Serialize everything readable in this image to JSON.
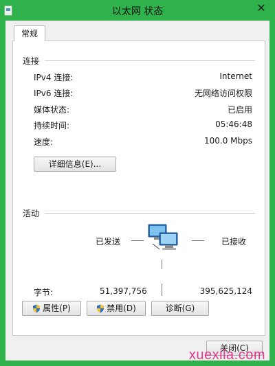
{
  "window": {
    "title": "以太网 状态",
    "close_glyph": "✕"
  },
  "tabs": [
    {
      "label": "常规"
    }
  ],
  "connection": {
    "header": "连接",
    "rows": [
      {
        "label": "IPv4 连接:",
        "value": "Internet"
      },
      {
        "label": "IPv6 连接:",
        "value": "无网络访问权限"
      },
      {
        "label": "媒体状态:",
        "value": "已启用"
      },
      {
        "label": "持续时间:",
        "value": "05:46:48"
      },
      {
        "label": "速度:",
        "value": "100.0 Mbps"
      }
    ],
    "details_button": "详细信息(E)..."
  },
  "activity": {
    "header": "活动",
    "sent_label": "已发送",
    "received_label": "已接收",
    "bytes_label": "字节:",
    "bytes_sent": "51,397,756",
    "bytes_received": "395,625,124"
  },
  "buttons": {
    "properties": "属性(P)",
    "disable": "禁用(D)",
    "diagnose": "诊断(G)",
    "close": "关闭(C)"
  },
  "icons": {
    "shield": "uac-shield-icon",
    "network": "network-computers-icon"
  },
  "watermark": "xuexila.com",
  "colors": {
    "frame": "#2fb24c",
    "client": "#f0f0f0",
    "panel": "#ffffff"
  }
}
